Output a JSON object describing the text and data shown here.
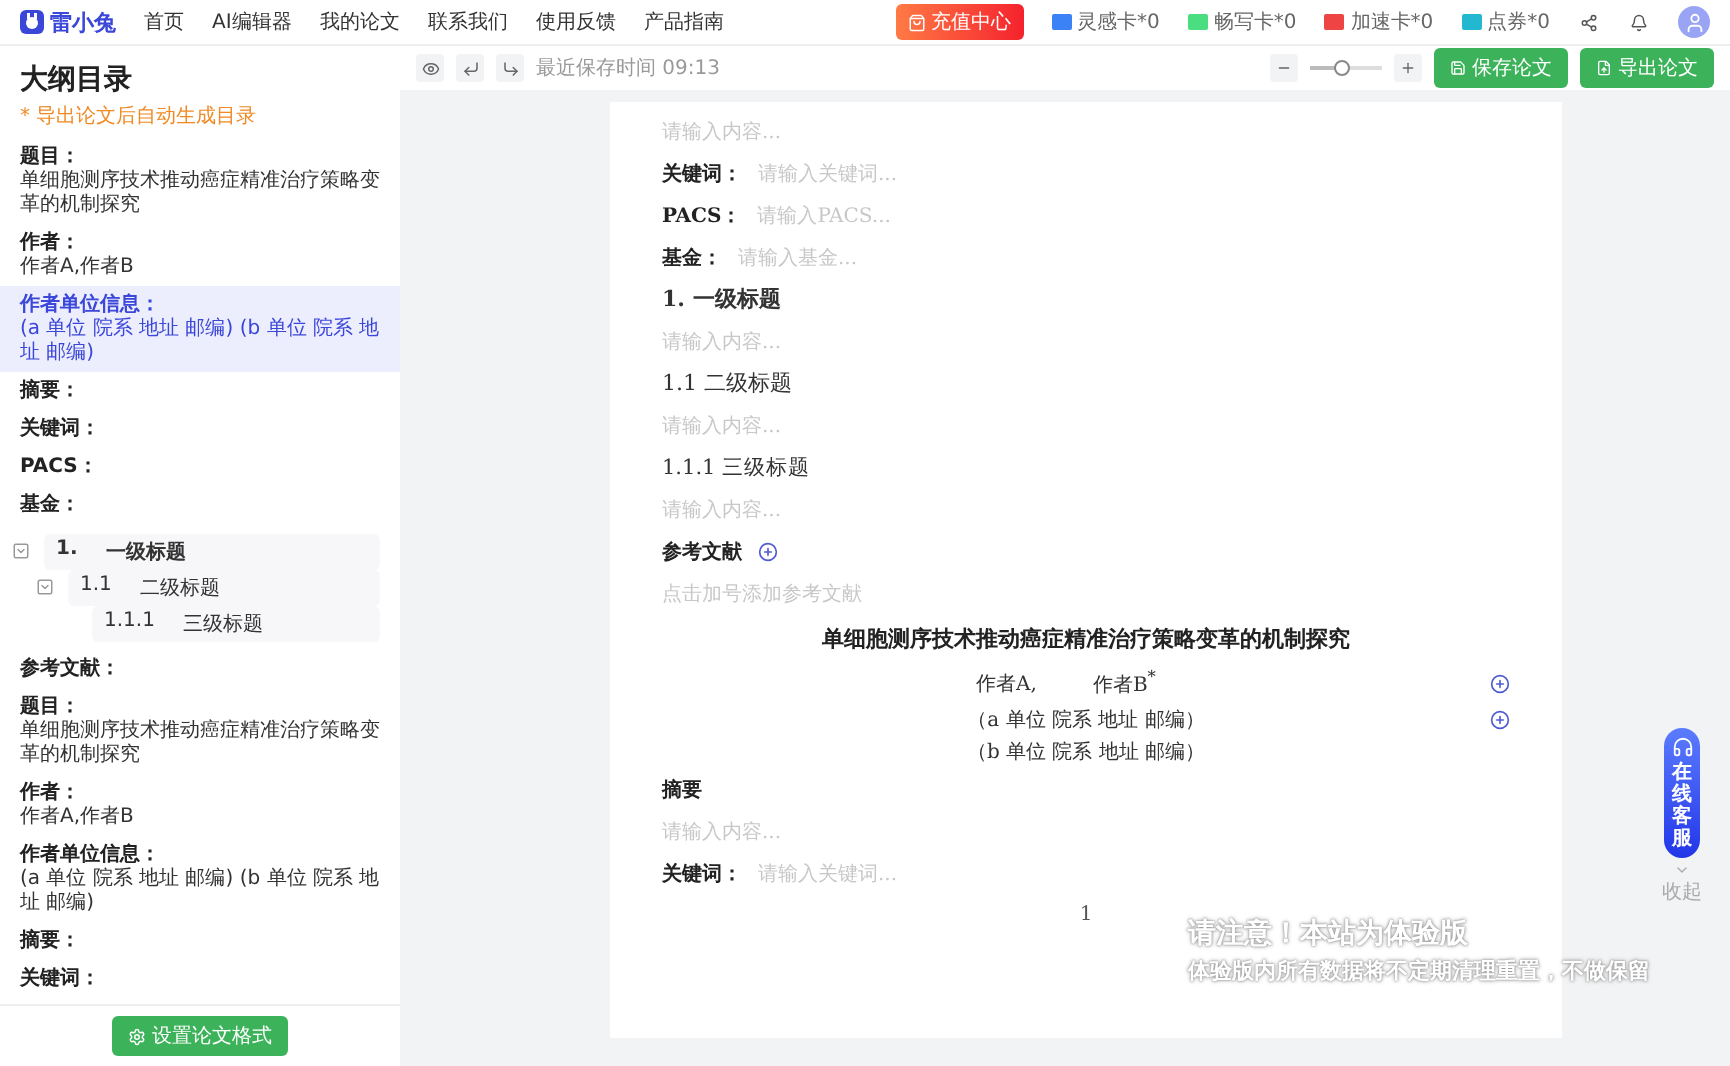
{
  "nav": {
    "logo": "雷小兔",
    "links": [
      "首页",
      "AI编辑器",
      "我的论文",
      "联系我们",
      "使用反馈",
      "产品指南"
    ],
    "recharge": "充值中心",
    "cards": [
      {
        "label": "灵感卡*0",
        "color": "#3b82f6"
      },
      {
        "label": "畅写卡*0",
        "color": "#4ade80"
      },
      {
        "label": "加速卡*0",
        "color": "#ef4444"
      },
      {
        "label": "点券*0",
        "color": "#22b8cf"
      }
    ]
  },
  "toolbar": {
    "save_time": "最近保存时间 09:13",
    "zoom": {
      "level": 0.45
    },
    "buttons": [
      "保存论文",
      "导出论文"
    ]
  },
  "sidebar": {
    "title": "大纲目录",
    "note": "* 导出论文后自动生成目录",
    "sections": [
      {
        "kind": "field",
        "label": "题目：",
        "value": "单细胞测序技术推动癌症精准治疗策略变革的机制探究",
        "selected": false
      },
      {
        "kind": "field",
        "label": "作者：",
        "value": "作者A,作者B",
        "selected": false
      },
      {
        "kind": "field",
        "label": "作者单位信息：",
        "value": "(a 单位 院系 地址 邮编) (b 单位 院系 地址 邮编)",
        "selected": true
      },
      {
        "kind": "field",
        "label": "摘要：",
        "selected": false
      },
      {
        "kind": "field",
        "label": "关键词：",
        "selected": false
      },
      {
        "kind": "field",
        "label": "PACS：",
        "selected": false
      },
      {
        "kind": "field",
        "label": "基金：",
        "selected": false
      },
      {
        "kind": "outline",
        "items": [
          {
            "number": "1.",
            "label": "一级标题",
            "expanded": true,
            "children": [
              {
                "number": "1.1",
                "label": "二级标题",
                "expanded": true,
                "children": [
                  {
                    "number": "1.1.1",
                    "label": "三级标题"
                  }
                ]
              }
            ]
          }
        ]
      },
      {
        "kind": "field",
        "label": "参考文献：",
        "selected": false
      },
      {
        "kind": "field",
        "label": "题目：",
        "value": "单细胞测序技术推动癌症精准治疗策略变革的机制探究",
        "selected": false
      },
      {
        "kind": "field",
        "label": "作者：",
        "value": "作者A,作者B",
        "selected": false
      },
      {
        "kind": "field",
        "label": "作者单位信息：",
        "value": "(a 单位 院系 地址 邮编) (b 单位 院系 地址 邮编)",
        "selected": false
      },
      {
        "kind": "field",
        "label": "摘要：",
        "selected": false
      },
      {
        "kind": "field",
        "label": "关键词：",
        "selected": false
      }
    ],
    "footer_button": "设置论文格式"
  },
  "paper": {
    "blocks": [
      {
        "kind": "placeholder",
        "text": "请输入内容..."
      },
      {
        "kind": "field",
        "label": "关键词：",
        "placeholder": "请输入关键词..."
      },
      {
        "kind": "field",
        "label": "PACS：",
        "placeholder": "请输入PACS..."
      },
      {
        "kind": "field",
        "label": "基金：",
        "placeholder": "请输入基金..."
      },
      {
        "kind": "heading1",
        "text": "1. 一级标题"
      },
      {
        "kind": "placeholder",
        "text": "请输入内容..."
      },
      {
        "kind": "heading2",
        "text": "1.1 二级标题"
      },
      {
        "kind": "placeholder",
        "text": "请输入内容..."
      },
      {
        "kind": "heading3",
        "text": "1.1.1 三级标题"
      },
      {
        "kind": "placeholder",
        "text": "请输入内容..."
      },
      {
        "kind": "references",
        "text": "参考文献"
      },
      {
        "kind": "hint",
        "text": "点击加号添加参考文献"
      },
      {
        "kind": "title",
        "text": "单细胞测序技术推动癌症精准治疗策略变革的机制探究"
      },
      {
        "kind": "authors",
        "names": [
          "作者A,",
          "作者B$^{*}$"
        ],
        "add_button": true
      },
      {
        "kind": "affiliation",
        "text": "（a 单位 院系 地址 邮编）",
        "add_button": true
      },
      {
        "kind": "affiliation",
        "text": "（b 单位 院系 地址 邮编）"
      },
      {
        "kind": "section",
        "text": "摘要"
      },
      {
        "kind": "placeholder",
        "text": "请输入内容..."
      },
      {
        "kind": "field",
        "label": "关键词：",
        "placeholder": "请输入关键词..."
      }
    ],
    "page_number": "1"
  },
  "float": {
    "service": "在线客服",
    "collapse": "收起"
  },
  "notice": {
    "title": "请注意！本站为体验版",
    "body": "体验版内所有数据将不定期清理重置，不做保留"
  }
}
